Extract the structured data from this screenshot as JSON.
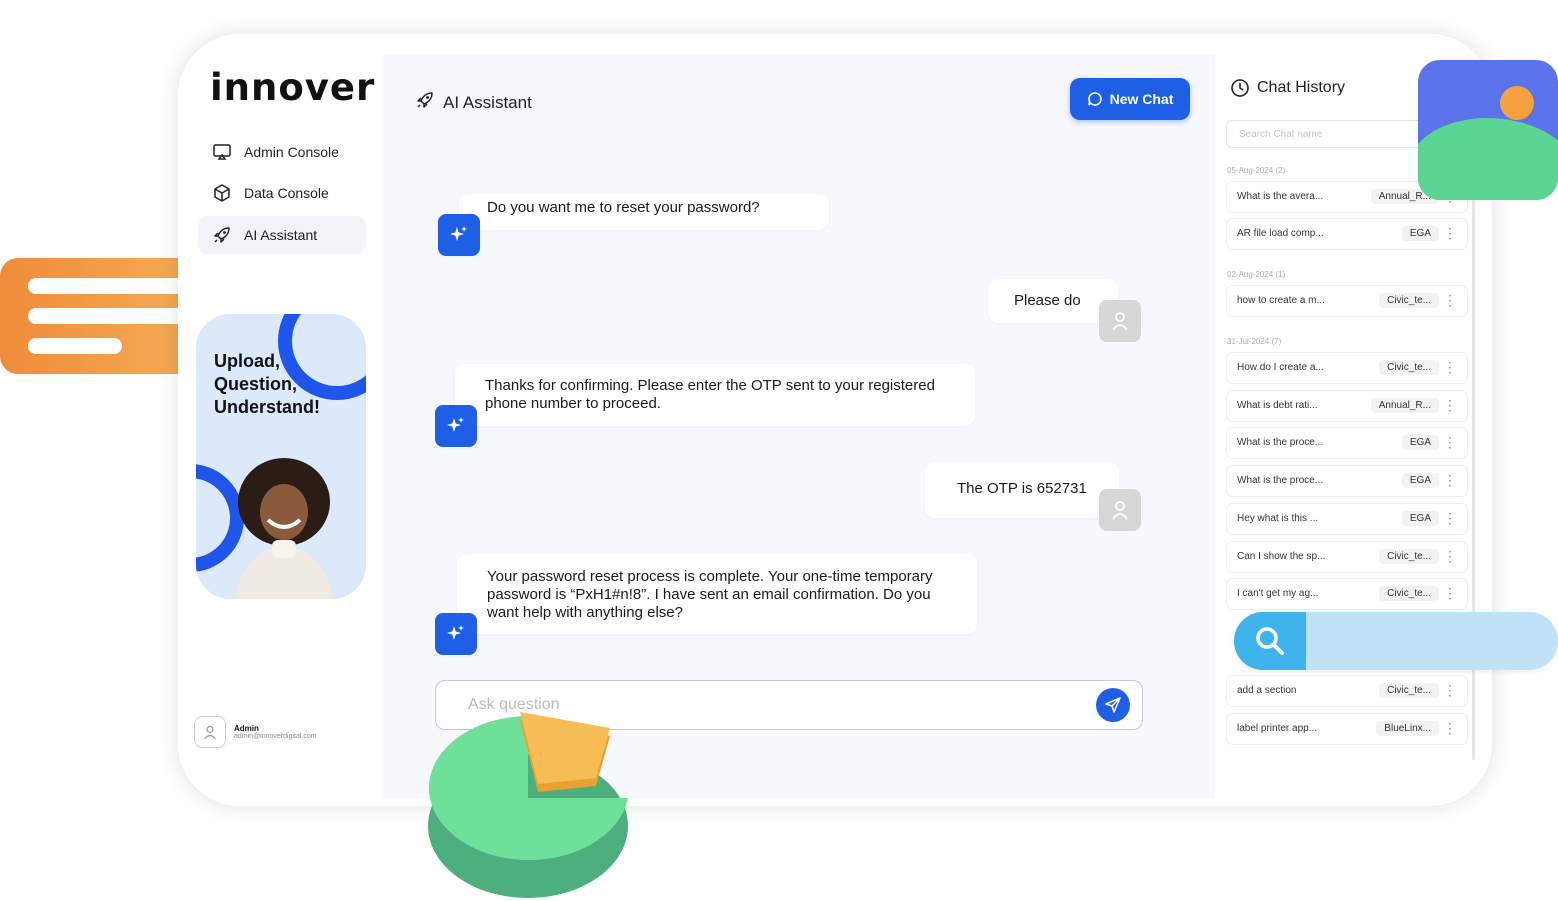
{
  "brand": {
    "logo_text": "innover"
  },
  "sidebar": {
    "items": [
      {
        "label": "Admin Console",
        "icon": "monitor-icon"
      },
      {
        "label": "Data Console",
        "icon": "cube-icon"
      },
      {
        "label": "AI Assistant",
        "icon": "rocket-icon",
        "active": true
      }
    ],
    "promo_text": "Upload,\nQuestion,\nUnderstand!",
    "user": {
      "name": "Admin",
      "email": "admin@innoverdigital.com"
    }
  },
  "main": {
    "title": "AI Assistant",
    "new_chat_label": "New Chat",
    "messages": [
      {
        "role": "assistant",
        "text": "Do you want me to reset your password?"
      },
      {
        "role": "user",
        "text": "Please do"
      },
      {
        "role": "assistant",
        "text": "Thanks for confirming. Please enter the OTP sent to your registered phone number to proceed."
      },
      {
        "role": "user",
        "text": "The OTP is 652731"
      },
      {
        "role": "assistant",
        "text": "Your password reset process is complete. Your one-time temporary password is “PxH1#n!8”. I have sent an email confirmation. Do you want help with anything else?"
      }
    ],
    "ask_placeholder": "Ask question"
  },
  "history": {
    "title": "Chat History",
    "search_placeholder": "Search Chat name",
    "groups": [
      {
        "date": "05-Aug-2024 (2)",
        "items": [
          {
            "q": "What is the avera...",
            "tag": "Annual_R..."
          },
          {
            "q": "AR file load comp...",
            "tag": "EGA"
          }
        ]
      },
      {
        "date": "02-Aug-2024 (1)",
        "items": [
          {
            "q": "how to create a m...",
            "tag": "Civic_te..."
          }
        ]
      },
      {
        "date": "31-Jul-2024 (7)",
        "items": [
          {
            "q": "How do I create a...",
            "tag": "Civic_te..."
          },
          {
            "q": "What is debt rati...",
            "tag": "Annual_R..."
          },
          {
            "q": "What is the proce...",
            "tag": "EGA"
          },
          {
            "q": "What is the proce...",
            "tag": "EGA"
          },
          {
            "q": "Hey what is this ...",
            "tag": "EGA"
          },
          {
            "q": "Can I show the sp...",
            "tag": "Civic_te..."
          },
          {
            "q": "I can't get my ag...",
            "tag": "Civic_te..."
          }
        ]
      },
      {
        "date": "",
        "items": [
          {
            "q": "add a section",
            "tag": "Civic_te..."
          },
          {
            "q": "label printer app...",
            "tag": "BlueLinx..."
          }
        ]
      }
    ]
  },
  "colors": {
    "accent": "#1f5fe6",
    "orange": "#f08c3a",
    "green": "#5cd492",
    "sky": "#3fb3ec"
  }
}
